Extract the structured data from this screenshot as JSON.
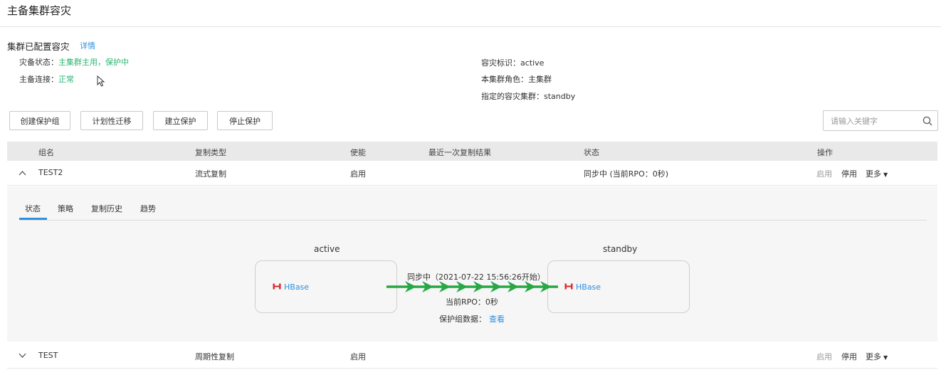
{
  "page": {
    "title": "主备集群容灾"
  },
  "summary": {
    "title": "集群已配置容灾",
    "detail_link": "详情",
    "dr_status_label": "灾备状态：",
    "dr_status_value": "主集群主用，保护中",
    "connection_label": "主备连接：",
    "connection_value": "正常",
    "dr_id_label": "容灾标识：",
    "dr_id_value": "active",
    "role_label": "本集群角色：",
    "role_value": "主集群",
    "target_label": "指定的容灾集群：",
    "target_value": "standby"
  },
  "toolbar": {
    "create_group": "创建保护组",
    "planned_migration": "计划性迁移",
    "start_protection": "建立保护",
    "stop_protection": "停止保护"
  },
  "search": {
    "placeholder": "请输入关键字"
  },
  "table": {
    "headers": {
      "name": "组名",
      "copy_type": "复制类型",
      "enabled": "使能",
      "last_result": "最近一次复制结果",
      "status": "状态",
      "actions": "操作"
    },
    "rows": [
      {
        "name": "TEST2",
        "copy_type": "流式复制",
        "enabled": "启用",
        "last_result": "",
        "status": "同步中 (当前RPO：0秒)",
        "act_enable": "启用",
        "act_disable": "停用",
        "act_more": "更多"
      },
      {
        "name": "TEST",
        "copy_type": "周期性复制",
        "enabled": "启用",
        "last_result": "",
        "status": "",
        "act_enable": "启用",
        "act_disable": "停用",
        "act_more": "更多"
      }
    ]
  },
  "detail": {
    "tabs": [
      "状态",
      "策略",
      "复制历史",
      "趋势"
    ],
    "active_tab": "状态",
    "source_cluster": "active",
    "target_cluster": "standby",
    "source_service": "HBase",
    "target_service": "HBase",
    "sync_text": "同步中（2021-07-22 15:56:26开始）",
    "rpo_text": "当前RPO：0秒",
    "group_data_label": "保护组数据：",
    "group_data_link": "查看"
  },
  "colors": {
    "accent": "#2f8fe0",
    "status_ok": "#2bb673",
    "flow_arrow": "#27a845",
    "hbase_red": "#d8262c"
  }
}
